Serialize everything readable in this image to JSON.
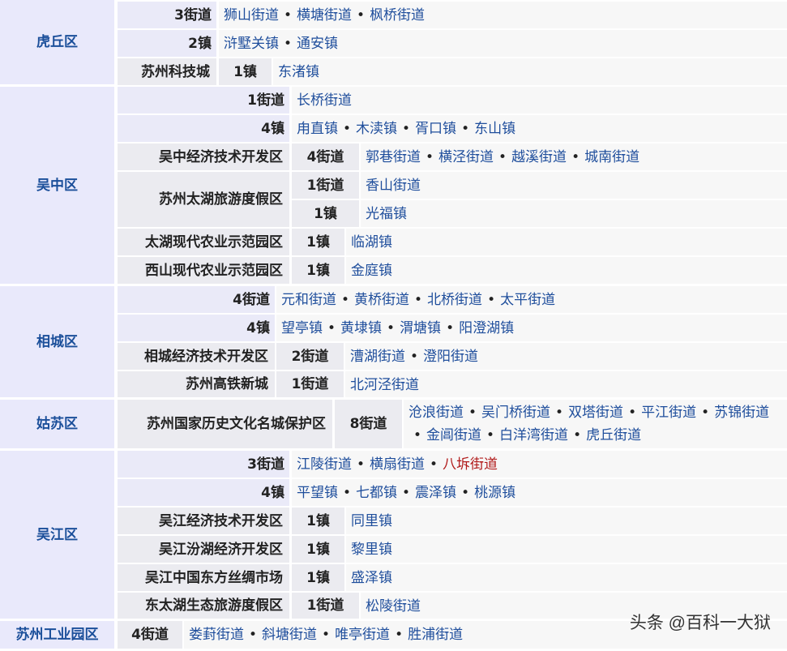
{
  "districts": [
    {
      "name": "虎丘区"
    },
    {
      "name": "吴中区"
    },
    {
      "name": "相城区"
    },
    {
      "name": "姑苏区"
    },
    {
      "name": "吴江区"
    },
    {
      "name": "苏州工业园区"
    }
  ],
  "rows": [
    {
      "sub": "",
      "count": "3街道",
      "items": [
        "狮山街道",
        "横塘街道",
        "枫桥街道"
      ]
    },
    {
      "sub": "",
      "count": "2镇",
      "items": [
        "浒墅关镇",
        "通安镇"
      ]
    },
    {
      "sub": "苏州科技城",
      "count": "1镇",
      "items": [
        "东渚镇"
      ]
    },
    {
      "sub": "",
      "count": "1街道",
      "items": [
        "长桥街道"
      ]
    },
    {
      "sub": "",
      "count": "4镇",
      "items": [
        "甪直镇",
        "木渎镇",
        "胥口镇",
        "东山镇"
      ]
    },
    {
      "sub": "吴中经济技术开发区",
      "count": "4街道",
      "items": [
        "郭巷街道",
        "横泾街道",
        "越溪街道",
        "城南街道"
      ]
    },
    {
      "sub": "苏州太湖旅游度假区",
      "count": "1街道",
      "items": [
        "香山街道"
      ]
    },
    {
      "sub": "",
      "count": "1镇",
      "items": [
        "光福镇"
      ]
    },
    {
      "sub": "太湖现代农业示范园区",
      "count": "1镇",
      "items": [
        "临湖镇"
      ]
    },
    {
      "sub": "西山现代农业示范园区",
      "count": "1镇",
      "items": [
        "金庭镇"
      ]
    },
    {
      "sub": "",
      "count": "4街道",
      "items": [
        "元和街道",
        "黄桥街道",
        "北桥街道",
        "太平街道"
      ]
    },
    {
      "sub": "",
      "count": "4镇",
      "items": [
        "望亭镇",
        "黄埭镇",
        "渭塘镇",
        "阳澄湖镇"
      ]
    },
    {
      "sub": "相城经济技术开发区",
      "count": "2街道",
      "items": [
        "漕湖街道",
        "澄阳街道"
      ]
    },
    {
      "sub": "苏州高铁新城",
      "count": "1街道",
      "items": [
        "北河泾街道"
      ]
    },
    {
      "sub": "苏州国家历史文化名城保护区",
      "count": "8街道",
      "items": [
        "沧浪街道",
        "吴门桥街道",
        "双塔街道",
        "平江街道",
        "苏锦街道",
        "金阊街道",
        "白洋湾街道",
        "虎丘街道"
      ]
    },
    {
      "sub": "",
      "count": "3街道",
      "items": [
        "江陵街道",
        "横扇街道",
        "八坼街道"
      ]
    },
    {
      "sub": "",
      "count": "4镇",
      "items": [
        "平望镇",
        "七都镇",
        "震泽镇",
        "桃源镇"
      ]
    },
    {
      "sub": "吴江经济技术开发区",
      "count": "1镇",
      "items": [
        "同里镇"
      ]
    },
    {
      "sub": "吴江汾湖经济开发区",
      "count": "1镇",
      "items": [
        "黎里镇"
      ]
    },
    {
      "sub": "吴江中国东方丝绸市场",
      "count": "1镇",
      "items": [
        "盛泽镇"
      ]
    },
    {
      "sub": "东太湖生态旅游度假区",
      "count": "1街道",
      "items": [
        "松陵街道"
      ]
    },
    {
      "sub": "",
      "count": "4街道",
      "items": [
        "娄葑街道",
        "斜塘街道",
        "唯亭街道",
        "胜浦街道"
      ]
    }
  ],
  "separator": "•",
  "watermark": "头条 @百科一大狱"
}
